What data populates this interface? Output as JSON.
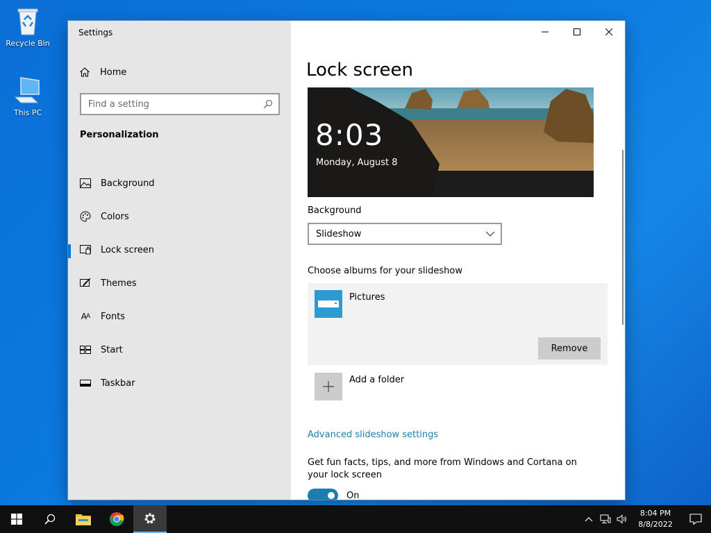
{
  "desktop": {
    "icons": [
      {
        "label": "Recycle Bin"
      },
      {
        "label": "This PC"
      }
    ]
  },
  "window": {
    "title": "Settings",
    "sidebar": {
      "home_label": "Home",
      "search_placeholder": "Find a setting",
      "section_title": "Personalization",
      "items": [
        {
          "label": "Background",
          "icon": "image-icon"
        },
        {
          "label": "Colors",
          "icon": "palette-icon"
        },
        {
          "label": "Lock screen",
          "icon": "lock-screen-icon",
          "active": true
        },
        {
          "label": "Themes",
          "icon": "brush-icon"
        },
        {
          "label": "Fonts",
          "icon": "font-icon"
        },
        {
          "label": "Start",
          "icon": "start-layout-icon"
        },
        {
          "label": "Taskbar",
          "icon": "taskbar-icon"
        }
      ]
    },
    "content": {
      "title": "Lock screen",
      "preview": {
        "time": "8:03",
        "date": "Monday, August 8"
      },
      "background_label": "Background",
      "background_value": "Slideshow",
      "albums_label": "Choose albums for your slideshow",
      "album_name": "Pictures",
      "remove_label": "Remove",
      "add_folder_label": "Add a folder",
      "advanced_link": "Advanced slideshow settings",
      "fun_facts_text": "Get fun facts, tips, and more from Windows and Cortana on your lock screen",
      "toggle_label": "On",
      "toggle_on": true
    }
  },
  "taskbar": {
    "clock_time": "8:04 PM",
    "clock_date": "8/8/2022"
  },
  "colors": {
    "accent": "#0078d7",
    "link": "#1a7fad",
    "sidebar_bg": "#e6e6e6",
    "desktop_bg": "#0b78df"
  }
}
